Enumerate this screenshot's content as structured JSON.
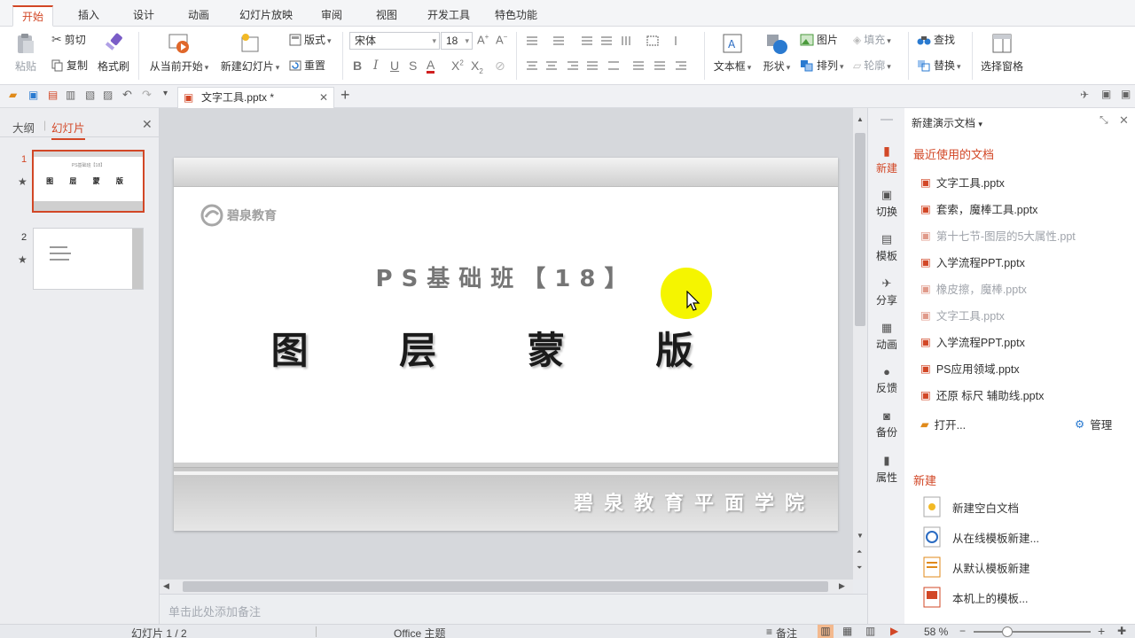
{
  "menu": {
    "tabs": [
      "开始",
      "插入",
      "设计",
      "动画",
      "幻灯片放映",
      "审阅",
      "视图",
      "开发工具",
      "特色功能"
    ],
    "active_index": 0
  },
  "ribbon": {
    "clipboard": {
      "paste": "粘贴",
      "cut": "剪切",
      "copy": "复制",
      "format_painter": "格式刷"
    },
    "slides": {
      "from_current": "从当前开始",
      "new_slide": "新建幻灯片",
      "layout": "版式",
      "reset": "重置"
    },
    "font": {
      "name": "宋体",
      "size": "18"
    },
    "insert": {
      "textbox": "文本框",
      "shape": "形状",
      "picture": "图片",
      "arrange": "排列",
      "fill": "填充",
      "outline": "轮廓"
    },
    "edit": {
      "find": "查找",
      "replace": "替换",
      "selection_pane": "选择窗格"
    }
  },
  "doc_tab": {
    "title": "文字工具.pptx *"
  },
  "left_panel": {
    "tabs": [
      "大纲",
      "幻灯片"
    ],
    "active_index": 1,
    "slides": [
      {
        "num": "1"
      },
      {
        "num": "2"
      }
    ]
  },
  "slide": {
    "logo_text": "碧泉教育",
    "subtitle": "PS基础班【18】",
    "title": "图 层 蒙 版",
    "footer": "碧泉教育平面学院"
  },
  "notes_placeholder": "单击此处添加备注",
  "right_strip": [
    "新建",
    "切换",
    "模板",
    "分享",
    "动画",
    "反馈",
    "备份",
    "属性"
  ],
  "task_pane": {
    "header": "新建演示文档",
    "recent_title": "最近使用的文档",
    "recent": [
      {
        "name": "文字工具.pptx",
        "dim": false
      },
      {
        "name": "套索，魔棒工具.pptx",
        "dim": false
      },
      {
        "name": "第十七节-图层的5大属性.ppt",
        "dim": true
      },
      {
        "name": "入学流程PPT.pptx",
        "dim": false
      },
      {
        "name": "橡皮擦，魔棒.pptx",
        "dim": true
      },
      {
        "name": "文字工具.pptx",
        "dim": true
      },
      {
        "name": "入学流程PPT.pptx",
        "dim": false
      },
      {
        "name": "PS应用领域.pptx",
        "dim": false
      },
      {
        "name": "还原 标尺 辅助线.pptx",
        "dim": false
      }
    ],
    "open": "打开...",
    "manage": "管理",
    "new_title": "新建",
    "new_items": [
      "新建空白文档",
      "从在线模板新建...",
      "从默认模板新建",
      "本机上的模板..."
    ]
  },
  "status": {
    "slide_count": "幻灯片 1 / 2",
    "theme": "Office 主题",
    "notes": "备注",
    "zoom": "58 %"
  },
  "colors": {
    "accent": "#d24726",
    "cursor_highlight": "#f5f500"
  }
}
